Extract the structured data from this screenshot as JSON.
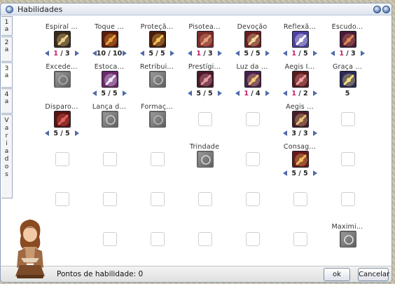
{
  "window": {
    "title": "Habilidades"
  },
  "tabs": [
    "1a",
    "2a",
    "3a",
    "4a",
    "Variados"
  ],
  "skills": [
    {
      "name": "Espiral ...",
      "level": "1",
      "max": "3",
      "icon": "spiral-pierce-icon",
      "colors": [
        "#e9d18a",
        "#3b2a1a"
      ]
    },
    {
      "name": "Toque ...",
      "level": "10",
      "max": "10",
      "icon": "holy-touch-icon",
      "colors": [
        "#f0a642",
        "#5a1d0c"
      ]
    },
    {
      "name": "Proteçã...",
      "level": "5",
      "max": "5",
      "icon": "protection-icon",
      "colors": [
        "#f7c35a",
        "#4a1e0a"
      ]
    },
    {
      "name": "Pisotea...",
      "level": "1",
      "max": "3",
      "icon": "trample-icon",
      "colors": [
        "#e5a07c",
        "#7b2d2a"
      ]
    },
    {
      "name": "Devoção",
      "level": "5",
      "max": "5",
      "icon": "devotion-icon",
      "colors": [
        "#f2d9a0",
        "#6b1f1f"
      ]
    },
    {
      "name": "Reflexã...",
      "level": "1",
      "max": "5",
      "icon": "reflect-icon",
      "colors": [
        "#ffffff",
        "#4b3fa3"
      ]
    },
    {
      "name": "Escudo...",
      "level": "1",
      "max": "3",
      "icon": "shield-icon",
      "colors": [
        "#e08a5a",
        "#4a1a3a"
      ]
    },
    {
      "name": "Excede...",
      "level": "",
      "max": "",
      "icon": "exceed-icon",
      "colors": [
        "#b0b0b0",
        "#5a5a5a"
      ]
    },
    {
      "name": "Estoca...",
      "level": "5",
      "max": "5",
      "icon": "lance-thrust-icon",
      "colors": [
        "#f4e9ff",
        "#6a2a6a"
      ]
    },
    {
      "name": "Retribui...",
      "level": "",
      "max": "",
      "icon": "retribution-icon",
      "colors": [
        "#bfbfbf",
        "#5c5c5c"
      ]
    },
    {
      "name": "Prestígi...",
      "level": "5",
      "max": "5",
      "icon": "prestige-icon",
      "colors": [
        "#e59aa0",
        "#4a1a2a"
      ]
    },
    {
      "name": "Luz da ...",
      "level": "1",
      "max": "4",
      "icon": "holy-light-icon",
      "colors": [
        "#f7c978",
        "#4a2050"
      ]
    },
    {
      "name": "Aegis I...",
      "level": "1",
      "max": "2",
      "icon": "aegis-sword-icon",
      "colors": [
        "#f0a0a0",
        "#5a1a1a"
      ]
    },
    {
      "name": "Graça ...",
      "level": "5",
      "max": "",
      "icon": "grace-icon",
      "colors": [
        "#f4e07a",
        "#2b2a5a"
      ]
    },
    {
      "name": "Disparo...",
      "level": "5",
      "max": "5",
      "icon": "shield-shot-icon",
      "colors": [
        "#e86060",
        "#5a1410"
      ]
    },
    {
      "name": "Lança d...",
      "level": "",
      "max": "",
      "icon": "spear-icon",
      "colors": [
        "#c8c8c8",
        "#606060"
      ]
    },
    {
      "name": "Formaç...",
      "level": "",
      "max": "",
      "icon": "formation-icon",
      "colors": [
        "#b8b8b8",
        "#5e5e5e"
      ]
    },
    {
      "name": "Aegis ...",
      "level": "3",
      "max": "3",
      "icon": "aegis-shield-icon",
      "colors": [
        "#e9c07a",
        "#4a1f2a"
      ]
    },
    {
      "name": "Trindade",
      "level": "",
      "max": "",
      "icon": "trinity-icon",
      "colors": [
        "#d5d5d5",
        "#6a6a6a"
      ]
    },
    {
      "name": "Consag...",
      "level": "5",
      "max": "5",
      "icon": "consecration-icon",
      "colors": [
        "#f0c060",
        "#6a1a1a"
      ]
    },
    {
      "name": "Maximi...",
      "level": "",
      "max": "",
      "icon": "maximize-icon",
      "colors": [
        "#e0e0e0",
        "#606060"
      ]
    }
  ],
  "footer": {
    "points_label": "Pontos de habilidade: 0",
    "ok_label": "ok",
    "cancel_label": "Cancelar"
  },
  "colors": {
    "accent": "#c8186a",
    "arrow": "#5069a8",
    "window_border": "#8da0b8"
  }
}
